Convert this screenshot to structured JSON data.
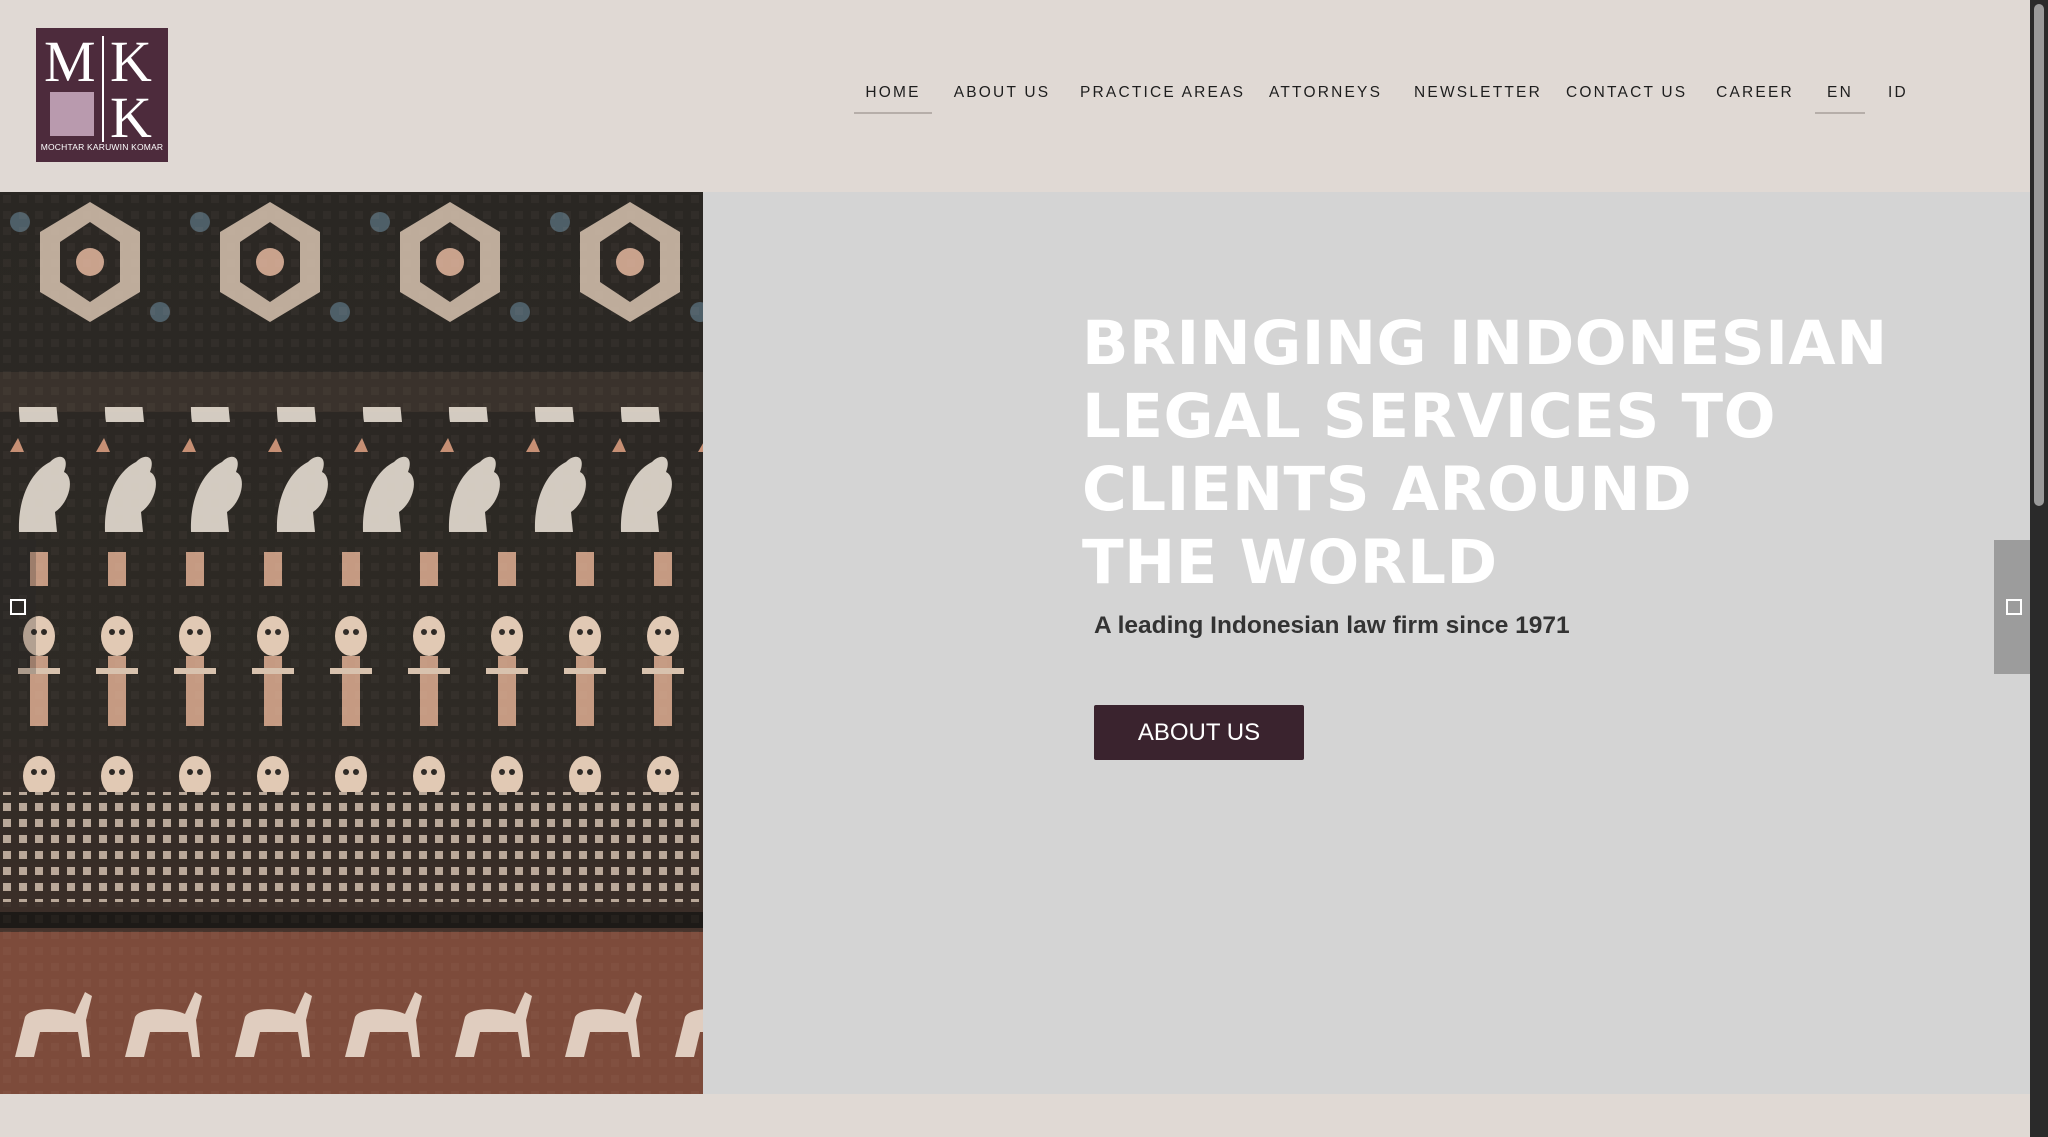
{
  "logo": {
    "letters": [
      "M",
      "K",
      "K"
    ],
    "caption": "MOCHTAR KARUWIN KOMAR"
  },
  "nav": {
    "items": [
      {
        "label": "HOME",
        "active": true
      },
      {
        "label": "ABOUT US",
        "active": false
      },
      {
        "label": "PRACTICE AREAS",
        "active": false
      },
      {
        "label": "ATTORNEYS",
        "active": false
      },
      {
        "label": "NEWSLETTER",
        "active": false
      },
      {
        "label": "CONTACT US",
        "active": false
      },
      {
        "label": "CAREER",
        "active": false
      },
      {
        "label": "EN",
        "active": true
      },
      {
        "label": "ID",
        "active": false
      }
    ]
  },
  "hero": {
    "headline": [
      "BRINGING INDONESIAN",
      "LEGAL SERVICES TO",
      "CLIENTS AROUND",
      "THE WORLD"
    ],
    "subline": "A leading Indonesian law firm since 1971",
    "cta_label": "ABOUT US"
  },
  "colors": {
    "page_bg": "#e0d9d4",
    "hero_bg": "#d4d4d4",
    "brand": "#4d2b3c",
    "button": "#3a232e",
    "headline": "#ffffff"
  }
}
